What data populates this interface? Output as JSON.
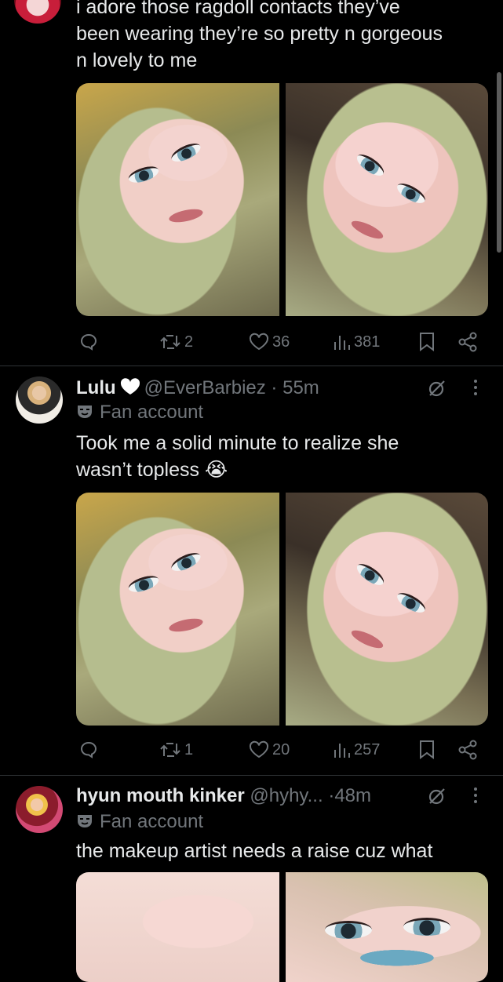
{
  "tweets": [
    {
      "text_lines": [
        "i adore those ragdoll contacts they’ve",
        "been wearing they’re so pretty n gorgeous",
        "n lovely to me"
      ],
      "actions": {
        "replies": "",
        "reposts": "2",
        "likes": "36",
        "views": "381"
      }
    },
    {
      "display_name": "Lulu",
      "handle": "@EverBarbiez",
      "dot": "·",
      "time": "55m",
      "label": "Fan account",
      "text_lines": [
        "Took me a solid minute to realize she",
        "wasn’t topless 😭"
      ],
      "actions": {
        "replies": "",
        "reposts": "1",
        "likes": "20",
        "views": "257"
      }
    },
    {
      "display_name": "hyun mouth kinker",
      "handle": "@hyhy...",
      "dot": "·",
      "time": "48m",
      "label": "Fan account",
      "text_lines": [
        "the makeup artist needs a raise cuz what"
      ]
    }
  ],
  "icons": {
    "reply": "reply-icon",
    "repost": "repost-icon",
    "like": "heart-icon",
    "views": "views-icon",
    "bookmark": "bookmark-icon",
    "share": "share-icon",
    "grok": "grok-icon",
    "more": "more-icon",
    "label": "mask-icon",
    "verified_heart": "white-heart-icon"
  },
  "colors": {
    "background": "#000000",
    "text": "#e7e9ea",
    "muted": "#71767b",
    "divider": "#2f3336"
  }
}
